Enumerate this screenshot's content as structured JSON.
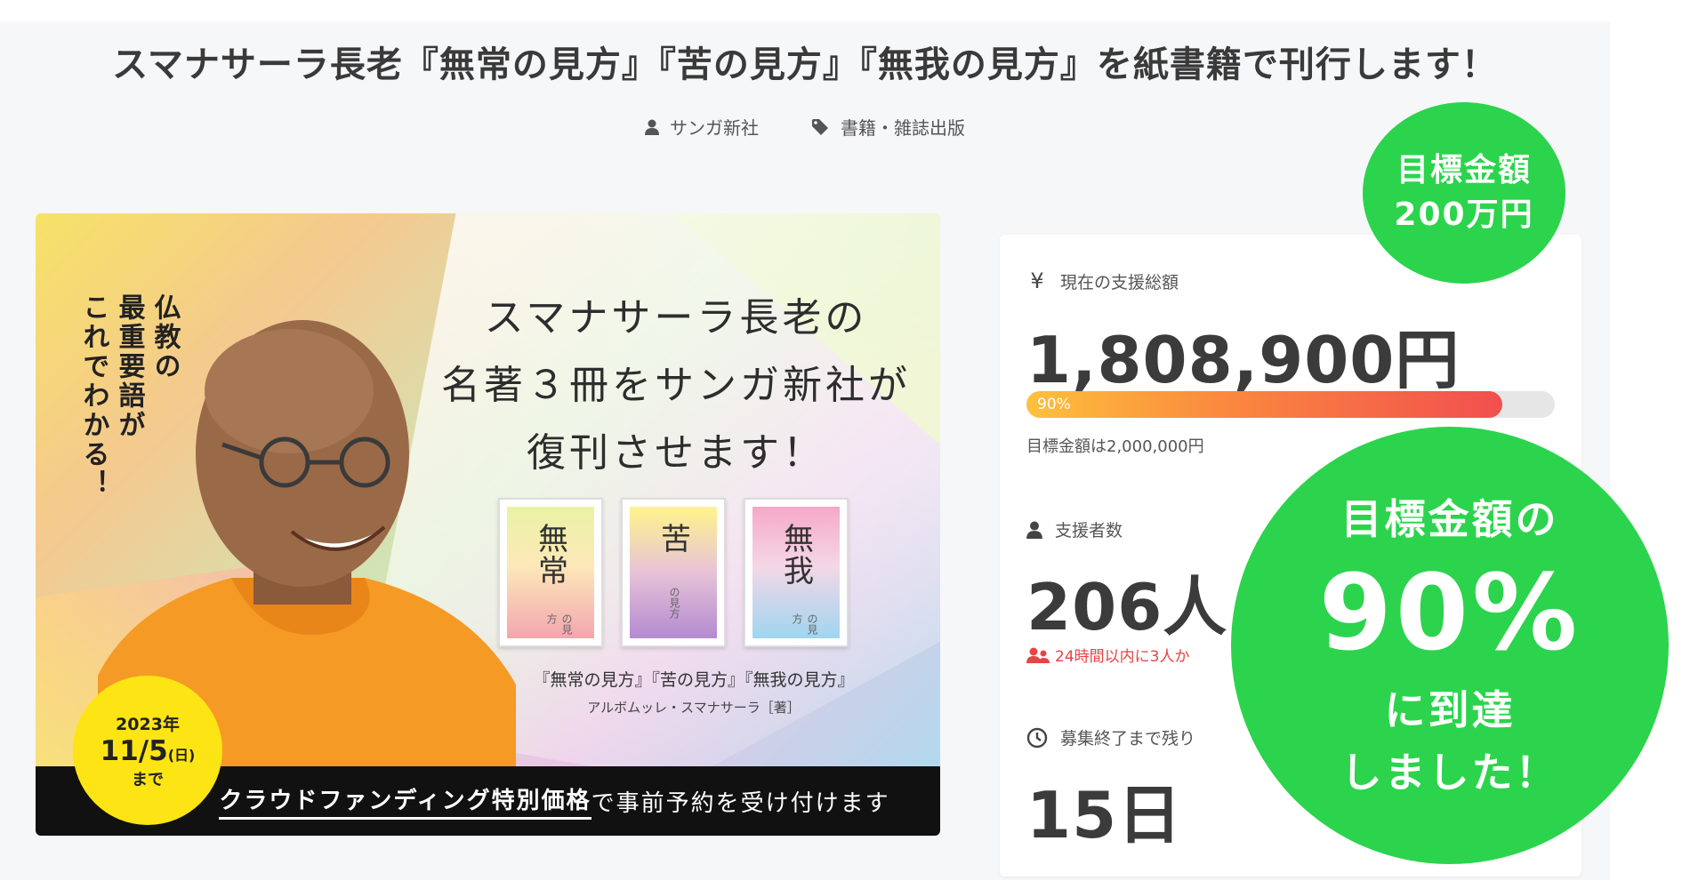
{
  "project": {
    "title": "スマナサーラ長老『無常の見方』『苦の見方』『無我の見方』を紙書籍で刊行します！",
    "author": "サンガ新社",
    "category": "書籍・雑誌出版"
  },
  "hero": {
    "vertical_lines": [
      "仏教の",
      "最重要語が",
      "これでわかる！"
    ],
    "headline": [
      "スマナサーラ長老の",
      "名著３冊をサンガ新社が",
      "復刊させます！"
    ],
    "books": [
      {
        "title": "無常",
        "sub": "の見方",
        "color": "#f3a6b0"
      },
      {
        "title": "苦",
        "sub": "の見方",
        "color": "#b48ad0"
      },
      {
        "title": "無我",
        "sub": "の見方",
        "color": "#9fd6f0"
      }
    ],
    "book_titles": "『無常の見方』『苦の見方』『無我の見方』",
    "book_author": "アルボムッレ・スマナサーラ［著］",
    "deadline": {
      "year": "2023年",
      "date": "11/5",
      "weekday": "(日)",
      "suffix": "まで"
    },
    "footer_emphasis": "クラウドファンディング特別価格",
    "footer_rest": "で事前予約を受け付けます"
  },
  "stats": {
    "total_label": "現在の支援総額",
    "total_value": "1,808,900円",
    "progress_label": "90%",
    "progress": 0.9,
    "goal_note": "目標金額は2,000,000円",
    "backers_label": "支援者数",
    "backers_value": "206人",
    "recent_text": "24時間以内に3人か",
    "remaining_label": "募集終了まで残り",
    "remaining_value": "15日"
  },
  "badges": {
    "goal_line1": "目標金額",
    "goal_line2": "200万円",
    "reach_line1": "目標金額の",
    "reach_pct": "90%",
    "reach_line3": "に到達",
    "reach_line4": "しました！"
  },
  "colors": {
    "accent_green": "#2bd44c",
    "progress_red": "#f14f4f",
    "deadline_yellow": "#fde414"
  }
}
